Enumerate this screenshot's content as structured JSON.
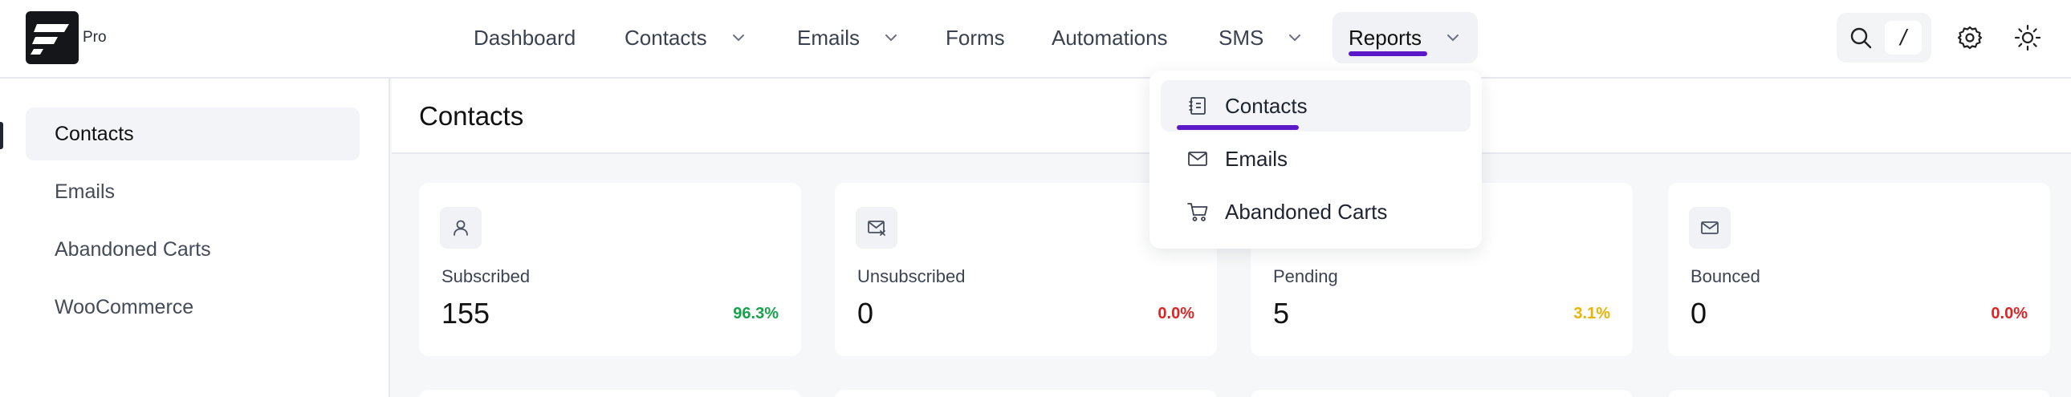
{
  "brand": {
    "badge": "Pro"
  },
  "nav": {
    "items": [
      {
        "label": "Dashboard"
      },
      {
        "label": "Contacts"
      },
      {
        "label": "Emails"
      },
      {
        "label": "Forms"
      },
      {
        "label": "Automations"
      },
      {
        "label": "SMS"
      },
      {
        "label": "Reports"
      }
    ],
    "active": "Reports"
  },
  "toolbar": {
    "shortcut_key": "/"
  },
  "sidebar": {
    "items": [
      {
        "label": "Contacts"
      },
      {
        "label": "Emails"
      },
      {
        "label": "Abandoned Carts"
      },
      {
        "label": "WooCommerce"
      }
    ]
  },
  "page": {
    "title": "Contacts"
  },
  "stats": [
    {
      "label": "Subscribed",
      "value": "155",
      "percent": "96.3%",
      "color": "#16a34a"
    },
    {
      "label": "Unsubscribed",
      "value": "0",
      "percent": "0.0%",
      "color": "#dc2626"
    },
    {
      "label": "Pending",
      "value": "5",
      "percent": "3.1%",
      "color": "#eab308"
    },
    {
      "label": "Bounced",
      "value": "0",
      "percent": "0.0%",
      "color": "#dc2626"
    }
  ],
  "reports_menu": {
    "items": [
      {
        "label": "Contacts",
        "icon": "contacts-book-icon"
      },
      {
        "label": "Emails",
        "icon": "mail-icon"
      },
      {
        "label": "Abandoned Carts",
        "icon": "cart-icon"
      }
    ]
  },
  "colors": {
    "accent": "#5b19c9"
  }
}
